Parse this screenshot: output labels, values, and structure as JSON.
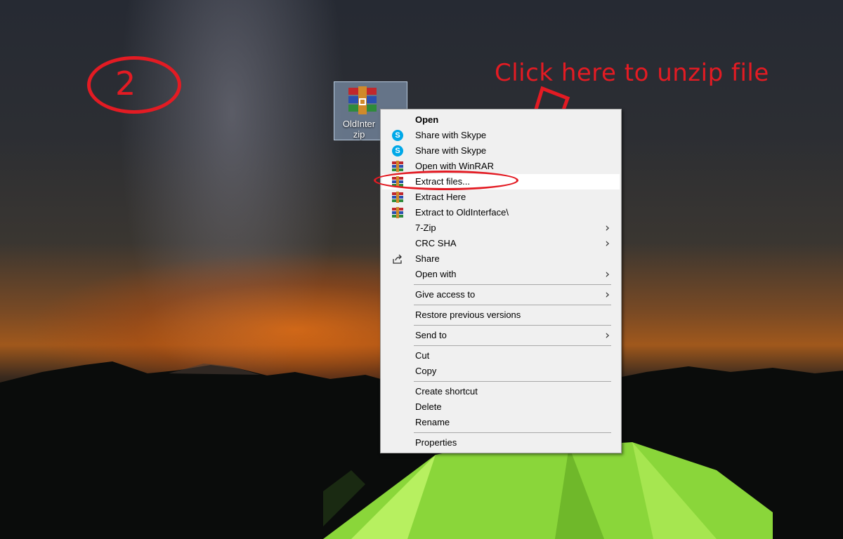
{
  "annotations": {
    "step_number": "2",
    "instruction": "Click here to unzip file",
    "color": "#e31b23"
  },
  "desktop_icon": {
    "name_line1": "OldInter",
    "name_line2": "zip",
    "icon": "winrar-archive-icon"
  },
  "context_menu": {
    "items": [
      {
        "label": "Open",
        "icon": null
      },
      {
        "label": "Share with Skype",
        "icon": "skype-icon"
      },
      {
        "label": "Share with Skype",
        "icon": "skype-icon"
      },
      {
        "label": "Open with WinRAR",
        "icon": "winrar-icon"
      },
      {
        "label": "Extract files...",
        "icon": "winrar-icon"
      },
      {
        "label": "Extract Here",
        "icon": "winrar-icon"
      },
      {
        "label": "Extract to OldInterface\\",
        "icon": "winrar-icon"
      },
      {
        "label": "7-Zip",
        "icon": null
      },
      {
        "label": "CRC SHA",
        "icon": null
      },
      {
        "label": "Share",
        "icon": "share-icon"
      },
      {
        "label": "Open with",
        "icon": null
      },
      {
        "label": "Give access to",
        "icon": null
      },
      {
        "label": "Restore previous versions",
        "icon": null
      },
      {
        "label": "Send to",
        "icon": null
      },
      {
        "label": "Cut",
        "icon": null
      },
      {
        "label": "Copy",
        "icon": null
      },
      {
        "label": "Create shortcut",
        "icon": null
      },
      {
        "label": "Delete",
        "icon": null
      },
      {
        "label": "Rename",
        "icon": null
      },
      {
        "label": "Properties",
        "icon": null
      }
    ],
    "submenu_glyph": "›"
  }
}
